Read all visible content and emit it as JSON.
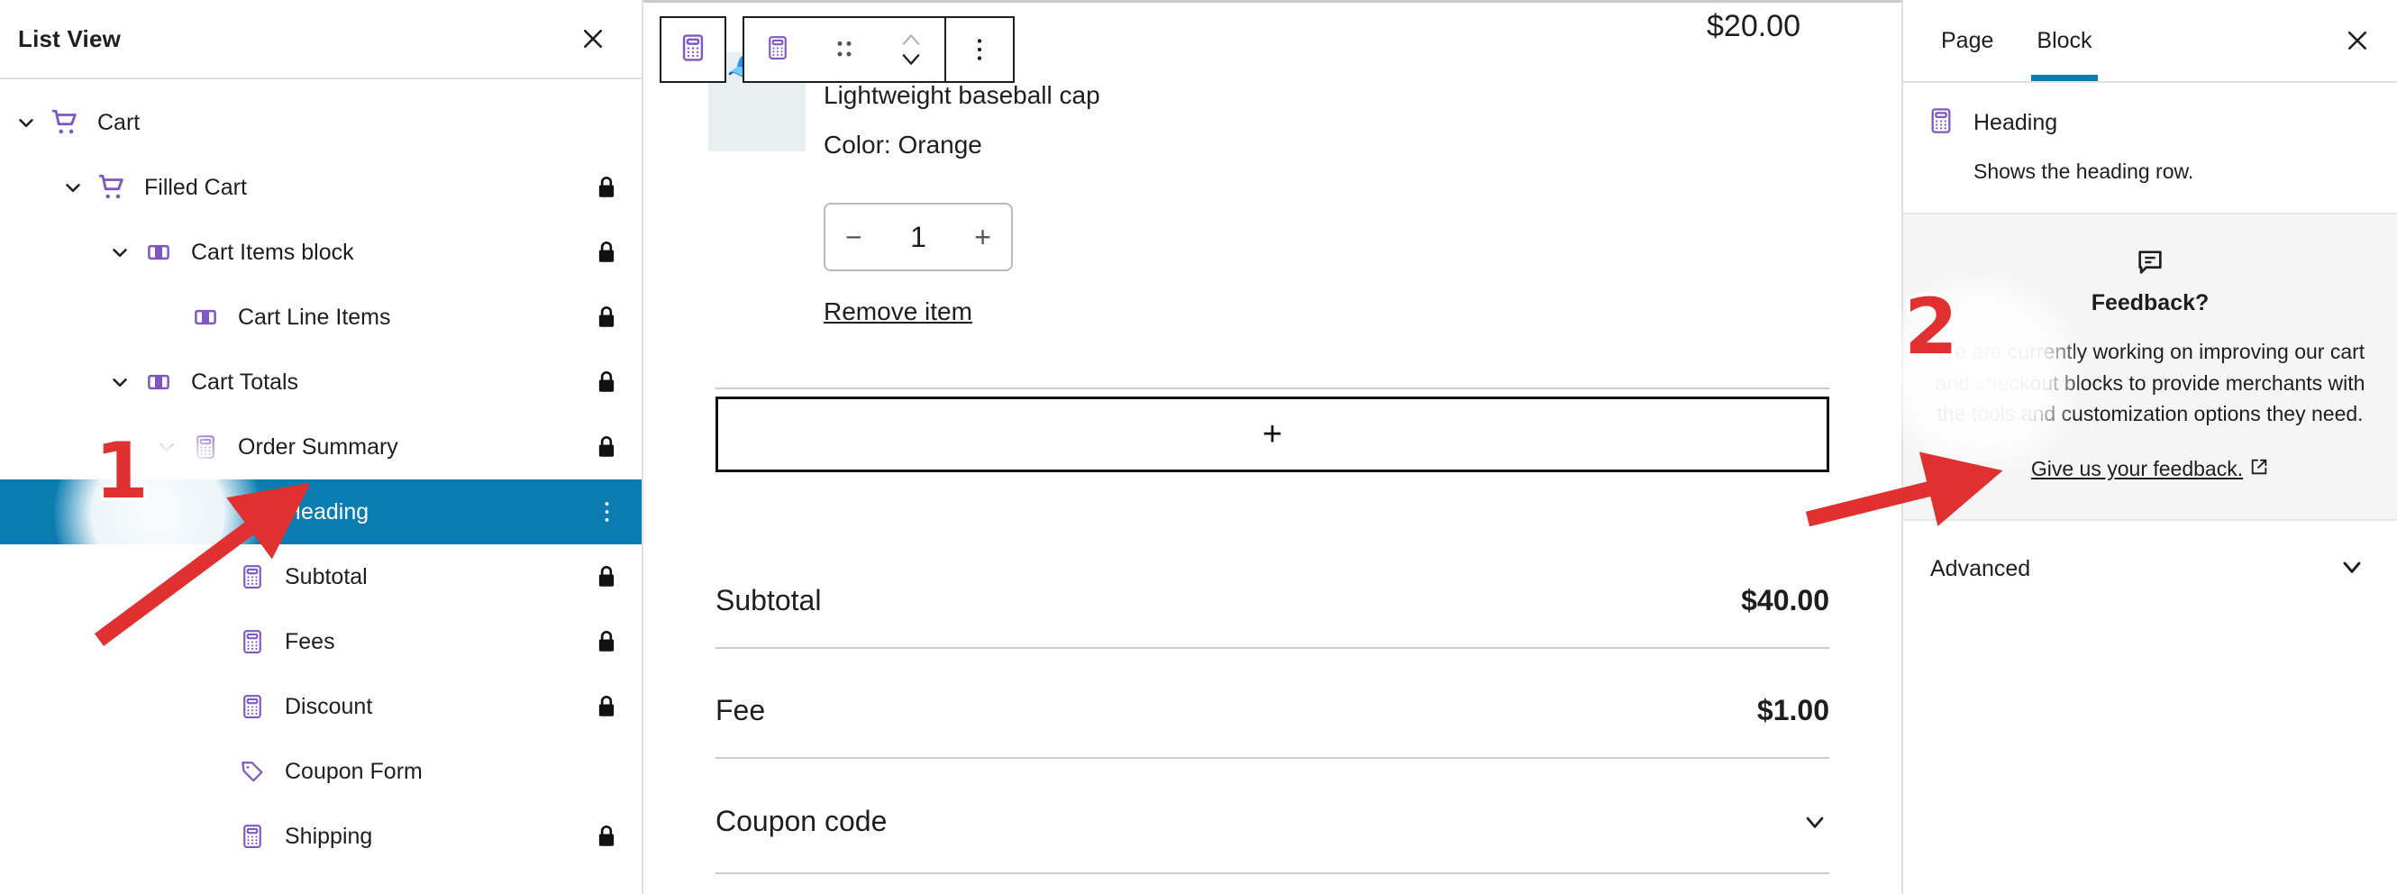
{
  "list_view": {
    "title": "List View",
    "close_icon": "close-icon",
    "items": [
      {
        "label": "Cart",
        "indent": 0,
        "icon": "cart-icon",
        "chevron": true,
        "locked": false,
        "selected": false
      },
      {
        "label": "Filled Cart",
        "indent": 1,
        "icon": "cart-icon",
        "chevron": true,
        "locked": true,
        "selected": false
      },
      {
        "label": "Cart Items block",
        "indent": 2,
        "icon": "columns-icon",
        "chevron": true,
        "locked": true,
        "selected": false
      },
      {
        "label": "Cart Line Items",
        "indent": 3,
        "icon": "columns-icon",
        "chevron": false,
        "locked": true,
        "selected": false
      },
      {
        "label": "Cart Totals",
        "indent": 2,
        "icon": "columns-icon",
        "chevron": true,
        "locked": true,
        "selected": false
      },
      {
        "label": "Order Summary",
        "indent": 3,
        "icon": "calculator-icon",
        "chevron": true,
        "locked": true,
        "selected": false
      },
      {
        "label": "Heading",
        "indent": 4,
        "icon": "calculator-icon",
        "chevron": false,
        "locked": false,
        "selected": true,
        "kebab": true
      },
      {
        "label": "Subtotal",
        "indent": 4,
        "icon": "calculator-icon",
        "chevron": false,
        "locked": true,
        "selected": false
      },
      {
        "label": "Fees",
        "indent": 4,
        "icon": "calculator-icon",
        "chevron": false,
        "locked": true,
        "selected": false
      },
      {
        "label": "Discount",
        "indent": 4,
        "icon": "calculator-icon",
        "chevron": false,
        "locked": true,
        "selected": false
      },
      {
        "label": "Coupon Form",
        "indent": 4,
        "icon": "tag-icon",
        "chevron": false,
        "locked": false,
        "selected": false
      },
      {
        "label": "Shipping",
        "indent": 4,
        "icon": "calculator-icon",
        "chevron": false,
        "locked": true,
        "selected": false
      }
    ]
  },
  "canvas": {
    "toolbar": {
      "block_icon": "calculator-icon",
      "parent_block_icon": "calculator-icon",
      "drag_icon": "drag-handle-icon",
      "move_up_icon": "chevron-up-icon",
      "move_down_icon": "chevron-down-icon",
      "options_icon": "more-vertical-icon"
    },
    "product": {
      "price": "$20.00",
      "name": "Lightweight baseball cap",
      "variant": "Color: Orange",
      "line_total": "$20.00",
      "quantity": "1",
      "decrease_label": "−",
      "increase_label": "+",
      "remove_label": "Remove item"
    },
    "inserter_label": "+",
    "totals": [
      {
        "label": "Subtotal",
        "value": "$40.00",
        "chevron": false
      },
      {
        "label": "Fee",
        "value": "$1.00",
        "chevron": false
      },
      {
        "label": "Coupon code",
        "value": "",
        "chevron": true
      }
    ]
  },
  "settings": {
    "tabs": [
      {
        "label": "Page",
        "active": false
      },
      {
        "label": "Block",
        "active": true
      }
    ],
    "close_icon": "close-icon",
    "block": {
      "icon": "calculator-icon",
      "title": "Heading",
      "description": "Shows the heading row."
    },
    "feedback": {
      "icon": "comment-icon",
      "title": "Feedback?",
      "body": "We are currently working on improving our cart and checkout blocks to provide merchants with the tools and customization options they need.",
      "link": "Give us your feedback.",
      "link_icon": "external-link-icon"
    },
    "advanced": {
      "label": "Advanced",
      "chevron_icon": "chevron-down-icon"
    }
  },
  "annotations": [
    {
      "number": "1",
      "target": "list-view-heading-row"
    },
    {
      "number": "2",
      "target": "settings-feedback-panel"
    }
  ],
  "colors": {
    "accent_blue": "#0b7cb0",
    "block_purple": "#7e57c2",
    "annotation_red": "#e03030",
    "panel_gray": "#f5f5f5"
  }
}
